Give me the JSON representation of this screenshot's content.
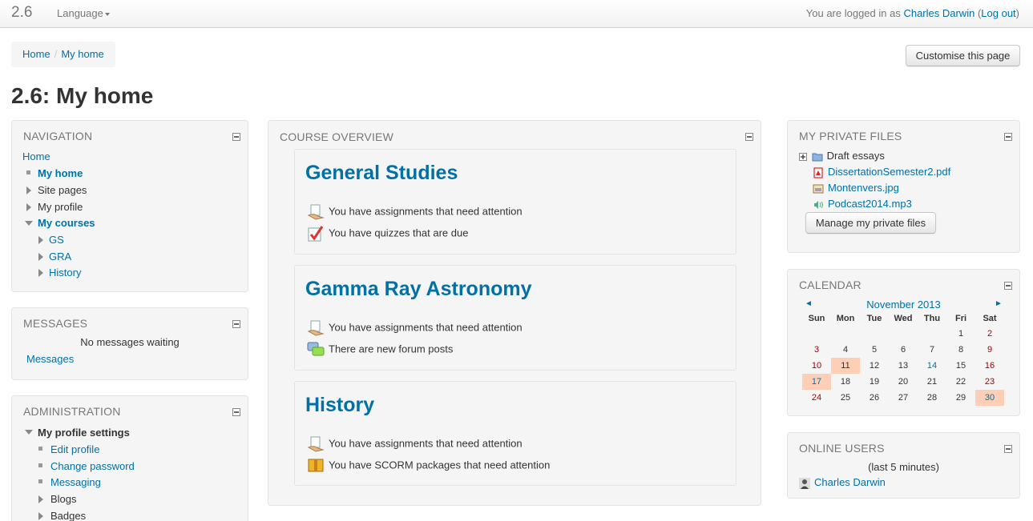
{
  "navbar": {
    "brand": "2.6",
    "language": "Language",
    "logged_prefix": "You are logged in as ",
    "user": "Charles Darwin",
    "logout_open": " (",
    "logout": "Log out",
    "logout_close": ")"
  },
  "breadcrumb": {
    "home": "Home",
    "sep": "/",
    "current": "My home"
  },
  "customise_button": "Customise this page",
  "page_title": "2.6: My home",
  "navigation": {
    "title": "NAVIGATION",
    "home": "Home",
    "my_home": "My home",
    "site_pages": "Site pages",
    "my_profile": "My profile",
    "my_courses": "My courses",
    "courses": [
      "GS",
      "GRA",
      "History"
    ]
  },
  "messages": {
    "title": "MESSAGES",
    "none": "No messages waiting",
    "link": "Messages"
  },
  "administration": {
    "title": "ADMINISTRATION",
    "profile_settings": "My profile settings",
    "items": [
      "Edit profile",
      "Change password",
      "Messaging",
      "Blogs",
      "Badges"
    ]
  },
  "course_overview": {
    "title": "COURSE OVERVIEW",
    "courses": [
      {
        "name": "General Studies",
        "items": [
          "You have assignments that need attention",
          "You have quizzes that are due"
        ]
      },
      {
        "name": "Gamma Ray Astronomy",
        "items": [
          "You have assignments that need attention",
          "There are new forum posts"
        ]
      },
      {
        "name": "History",
        "items": [
          "You have assignments that need attention",
          "You have SCORM packages that need attention"
        ]
      }
    ]
  },
  "private_files": {
    "title": "MY PRIVATE FILES",
    "folder": "Draft essays",
    "files": [
      "DissertationSemester2.pdf",
      "Montenvers.jpg",
      "Podcast2014.mp3"
    ],
    "manage_button": "Manage my private files"
  },
  "calendar": {
    "title": "CALENDAR",
    "month": "November 2013",
    "prev": "◄",
    "next": "►",
    "days": [
      "Sun",
      "Mon",
      "Tue",
      "Wed",
      "Thu",
      "Fri",
      "Sat"
    ],
    "weeks": [
      [
        "",
        "",
        "",
        "",
        "",
        "1",
        "2"
      ],
      [
        "3",
        "4",
        "5",
        "6",
        "7",
        "8",
        "9"
      ],
      [
        "10",
        "11",
        "12",
        "13",
        "14",
        "15",
        "16"
      ],
      [
        "17",
        "18",
        "19",
        "20",
        "21",
        "22",
        "23"
      ],
      [
        "24",
        "25",
        "26",
        "27",
        "28",
        "29",
        "30"
      ]
    ]
  },
  "online_users": {
    "title": "ONLINE USERS",
    "period": "(last 5 minutes)",
    "users": [
      "Charles Darwin"
    ]
  }
}
